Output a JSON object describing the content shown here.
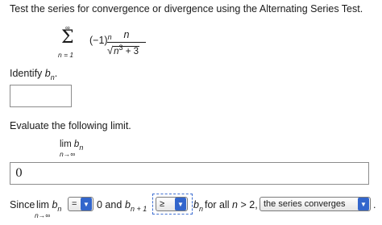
{
  "instructions": "Test the series for convergence or divergence using the Alternating Series Test.",
  "series": {
    "upper_limit": "∞",
    "sigma": "Σ",
    "lower_limit": "n = 1",
    "alt_factor": "(−1)",
    "alt_exponent": "n",
    "numerator": "n",
    "radicand_base": "n",
    "radicand_exponent": "3",
    "radicand_rest": " + 3"
  },
  "identify": {
    "label_prefix": "Identify ",
    "label_var": "b",
    "label_sub": "n",
    "label_suffix": ".",
    "answer": ""
  },
  "evaluate": {
    "label": "Evaluate the following limit.",
    "lim_word": "lim",
    "lim_var": "b",
    "lim_sub": "n",
    "lim_under": "n→∞",
    "answer": "0"
  },
  "since": {
    "since_word": "Since",
    "lim_word": "lim",
    "lim_var": "b",
    "lim_sub": "n",
    "lim_under": "n→∞",
    "relation_select": "=",
    "value_and": "0 and",
    "b_next": "b",
    "b_next_sub": "n + 1",
    "compare_select": "≥",
    "b_cur": "b",
    "b_cur_sub": "n",
    "for_all_prefix": "for all ",
    "for_all_var": "n",
    "for_all_suffix": " > 2,",
    "conclusion_select": "the series converges",
    "period": "."
  }
}
